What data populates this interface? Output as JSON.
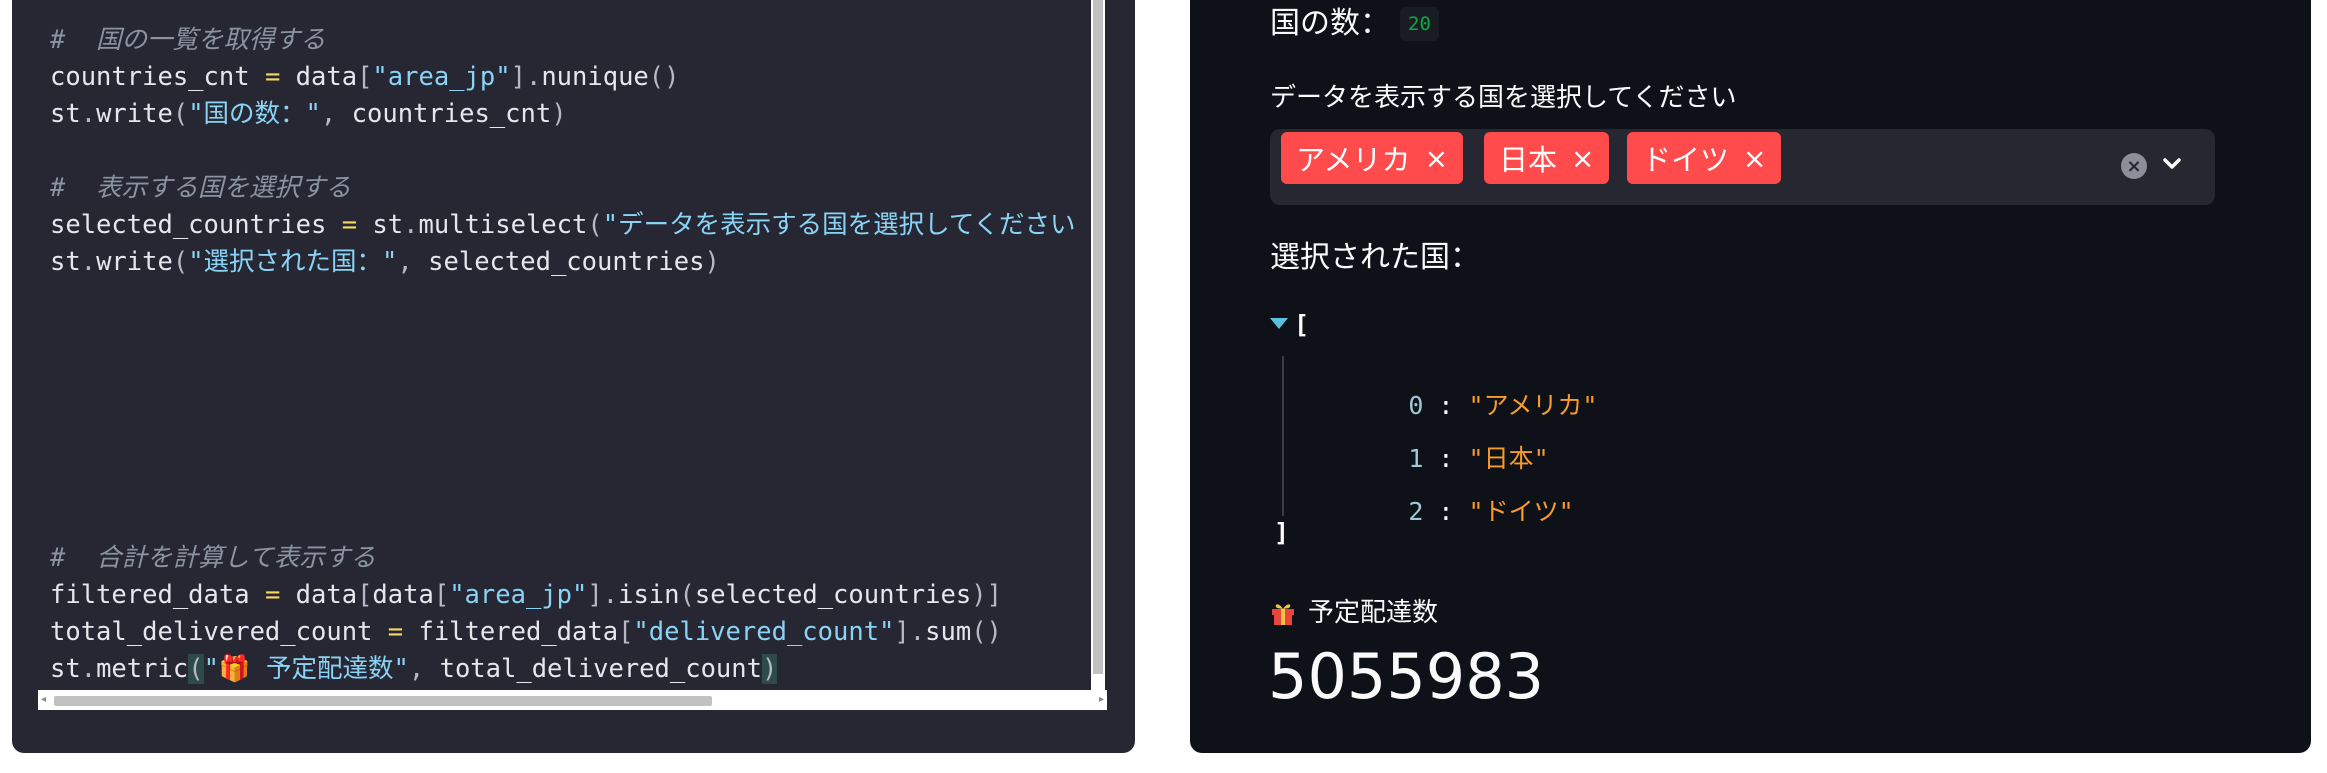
{
  "editor": {
    "code_lines": [
      {
        "segments": [
          {
            "t": "#  国の一覧を取得する",
            "c": "cm"
          }
        ]
      },
      {
        "segments": [
          {
            "t": "countries_cnt ",
            "c": ""
          },
          {
            "t": "=",
            "c": "op"
          },
          {
            "t": " data",
            "c": ""
          },
          {
            "t": "[",
            "c": "pn"
          },
          {
            "t": "\"area_jp\"",
            "c": "str"
          },
          {
            "t": "]",
            "c": "pn"
          },
          {
            "t": ".",
            "c": "pn"
          },
          {
            "t": "nunique",
            "c": ""
          },
          {
            "t": "()",
            "c": "pn"
          }
        ]
      },
      {
        "segments": [
          {
            "t": "st",
            "c": ""
          },
          {
            "t": ".",
            "c": "pn"
          },
          {
            "t": "write",
            "c": ""
          },
          {
            "t": "(",
            "c": "pn"
          },
          {
            "t": "\"国の数：\"",
            "c": "str"
          },
          {
            "t": ",",
            "c": "pn"
          },
          {
            "t": " countries_cnt",
            "c": ""
          },
          {
            "t": ")",
            "c": "pn"
          }
        ]
      },
      {
        "segments": []
      },
      {
        "segments": [
          {
            "t": "#  表示する国を選択する",
            "c": "cm"
          }
        ]
      },
      {
        "segments": [
          {
            "t": "selected_countries ",
            "c": ""
          },
          {
            "t": "=",
            "c": "op"
          },
          {
            "t": " st",
            "c": ""
          },
          {
            "t": ".",
            "c": "pn"
          },
          {
            "t": "multiselect",
            "c": ""
          },
          {
            "t": "(",
            "c": "pn"
          },
          {
            "t": "\"データを表示する国を選択してください",
            "c": "str"
          }
        ]
      },
      {
        "segments": [
          {
            "t": "st",
            "c": ""
          },
          {
            "t": ".",
            "c": "pn"
          },
          {
            "t": "write",
            "c": ""
          },
          {
            "t": "(",
            "c": "pn"
          },
          {
            "t": "\"選択された国：\"",
            "c": "str"
          },
          {
            "t": ",",
            "c": "pn"
          },
          {
            "t": " selected_countries",
            "c": ""
          },
          {
            "t": ")",
            "c": "pn"
          }
        ]
      },
      {
        "segments": []
      },
      {
        "segments": []
      },
      {
        "segments": []
      },
      {
        "segments": []
      },
      {
        "segments": []
      },
      {
        "segments": []
      },
      {
        "segments": []
      },
      {
        "segments": [
          {
            "t": "#  合計を計算して表示する",
            "c": "cm"
          }
        ]
      },
      {
        "segments": [
          {
            "t": "filtered_data ",
            "c": ""
          },
          {
            "t": "=",
            "c": "op"
          },
          {
            "t": " data",
            "c": ""
          },
          {
            "t": "[",
            "c": "pn"
          },
          {
            "t": "data",
            "c": ""
          },
          {
            "t": "[",
            "c": "pn"
          },
          {
            "t": "\"area_jp\"",
            "c": "str"
          },
          {
            "t": "]",
            "c": "pn"
          },
          {
            "t": ".",
            "c": "pn"
          },
          {
            "t": "isin",
            "c": ""
          },
          {
            "t": "(",
            "c": "pn"
          },
          {
            "t": "selected_countries",
            "c": ""
          },
          {
            "t": ")]",
            "c": "pn"
          }
        ]
      },
      {
        "segments": [
          {
            "t": "total_delivered_count ",
            "c": ""
          },
          {
            "t": "=",
            "c": "op"
          },
          {
            "t": " filtered_data",
            "c": ""
          },
          {
            "t": "[",
            "c": "pn"
          },
          {
            "t": "\"delivered_count\"",
            "c": "str"
          },
          {
            "t": "]",
            "c": "pn"
          },
          {
            "t": ".",
            "c": "pn"
          },
          {
            "t": "sum",
            "c": ""
          },
          {
            "t": "()",
            "c": "pn"
          }
        ]
      },
      {
        "segments": [
          {
            "t": "st",
            "c": ""
          },
          {
            "t": ".",
            "c": "pn"
          },
          {
            "t": "metric",
            "c": ""
          },
          {
            "t": "(",
            "c": "pn hl"
          },
          {
            "t": "\"🎁 予定配達数\"",
            "c": "str"
          },
          {
            "t": ",",
            "c": "pn"
          },
          {
            "t": " total_delivered_count",
            "c": ""
          },
          {
            "t": ")",
            "c": "pn hl"
          }
        ]
      }
    ]
  },
  "app": {
    "count_label": "国の数：",
    "count_value": "20",
    "select_label": "データを表示する国を選択してください",
    "selected_tags": [
      "アメリカ",
      "日本",
      "ドイツ"
    ],
    "tag_remove_glyph": "×",
    "clear_glyph": "×",
    "selected_label": "選択された国：",
    "json": {
      "open": "[",
      "close": "]",
      "rows": [
        {
          "index": "0",
          "value": "\"アメリカ\""
        },
        {
          "index": "1",
          "value": "\"日本\""
        },
        {
          "index": "2",
          "value": "\"ドイツ\""
        }
      ]
    },
    "metric_label": "予定配達数",
    "metric_icon": "gift-icon",
    "metric_value": "5055983"
  },
  "colors": {
    "editor_bg": "#272733",
    "app_bg": "#0e1117",
    "tag_bg": "#ff4b4b",
    "json_value": "#f99b29",
    "count_value": "#09ab3b"
  }
}
